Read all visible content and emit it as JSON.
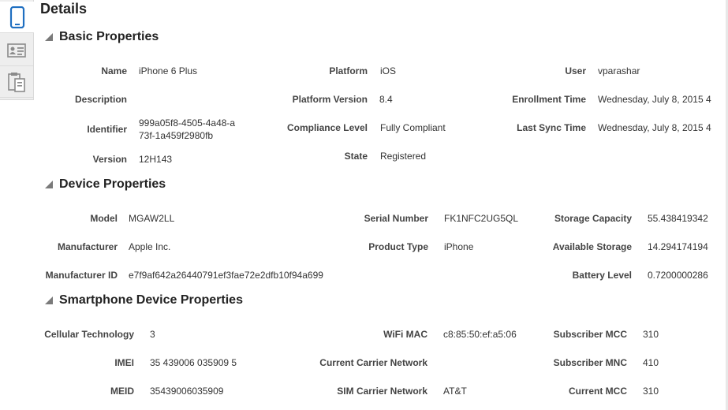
{
  "sidebar": {
    "tabs": [
      {
        "icon": "tablet-icon",
        "active": true
      },
      {
        "icon": "contact-card-icon",
        "active": false
      },
      {
        "icon": "clipboard-icon",
        "active": false
      }
    ]
  },
  "page_title": "Details",
  "sections": {
    "basic": {
      "title": "Basic Properties",
      "name_label": "Name",
      "name_value": "iPhone 6 Plus",
      "platform_label": "Platform",
      "platform_value": "iOS",
      "user_label": "User",
      "user_value": "vparashar",
      "description_label": "Description",
      "description_value": "",
      "platform_version_label": "Platform Version",
      "platform_version_value": "8.4",
      "enrollment_time_label": "Enrollment Time",
      "enrollment_time_value": "Wednesday, July 8, 2015 4",
      "identifier_label": "Identifier",
      "identifier_value": "999a05f8-4505-4a48-a73f-1a459f2980fb",
      "compliance_label": "Compliance Level",
      "compliance_value": "Fully Compliant",
      "last_sync_label": "Last Sync Time",
      "last_sync_value": "Wednesday, July 8, 2015 4",
      "version_label": "Version",
      "version_value": "12H143",
      "state_label": "State",
      "state_value": "Registered"
    },
    "device": {
      "title": "Device Properties",
      "model_label": "Model",
      "model_value": "MGAW2LL",
      "serial_label": "Serial Number",
      "serial_value": "FK1NFC2UG5QL",
      "storage_cap_label": "Storage Capacity",
      "storage_cap_value": "55.438419342",
      "manufacturer_label": "Manufacturer",
      "manufacturer_value": "Apple Inc.",
      "product_type_label": "Product Type",
      "product_type_value": "iPhone",
      "available_storage_label": "Available Storage",
      "available_storage_value": "14.294174194",
      "manufacturer_id_label": "Manufacturer ID",
      "manufacturer_id_value": "e7f9af642a26440791ef3fae72e2dfb10f94a699",
      "battery_label": "Battery Level",
      "battery_value": "0.7200000286"
    },
    "smartphone": {
      "title": "Smartphone Device Properties",
      "cellular_label": "Cellular Technology",
      "cellular_value": "3",
      "wifi_label": "WiFi MAC",
      "wifi_value": "c8:85:50:ef:a5:06",
      "sub_mcc_label": "Subscriber MCC",
      "sub_mcc_value": "310",
      "imei_label": "IMEI",
      "imei_value": "35 439006 035909 5",
      "carrier_label": "Current Carrier Network",
      "carrier_value": "",
      "sub_mnc_label": "Subscriber MNC",
      "sub_mnc_value": "410",
      "meid_label": "MEID",
      "meid_value": "35439006035909",
      "sim_label": "SIM Carrier Network",
      "sim_value": "AT&T",
      "cur_mcc_label": "Current MCC",
      "cur_mcc_value": "310"
    }
  }
}
